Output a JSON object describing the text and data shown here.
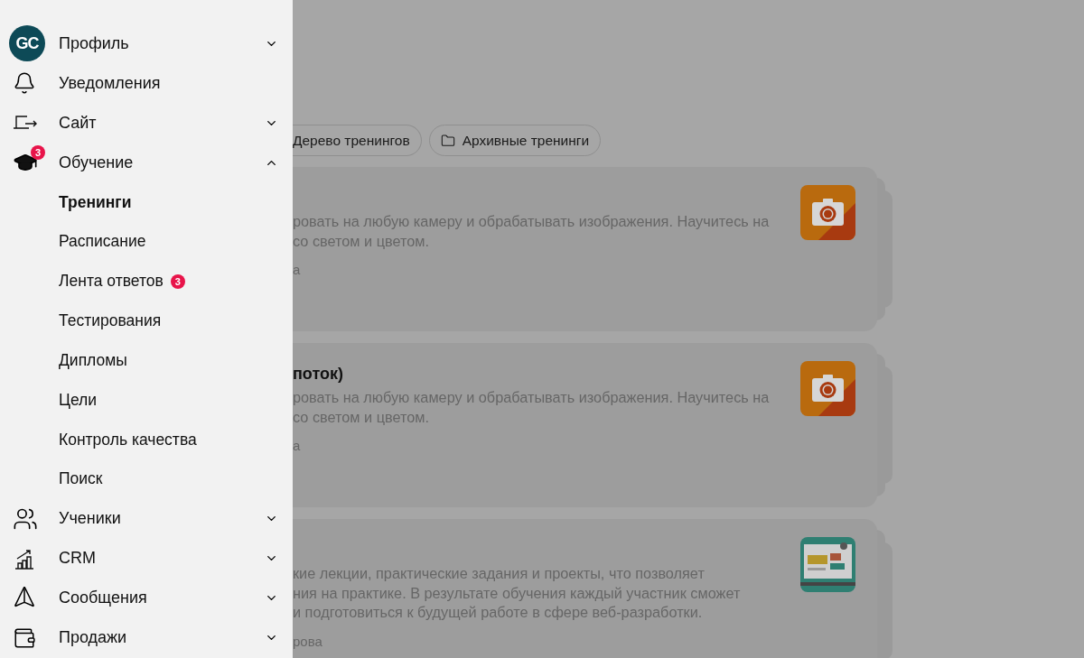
{
  "sidebar": {
    "avatar": "GC",
    "items": [
      {
        "label": "Профиль",
        "kind": "profile",
        "expanded": false
      },
      {
        "label": "Уведомления",
        "kind": "bell"
      },
      {
        "label": "Сайт",
        "kind": "site",
        "expanded": false
      },
      {
        "label": "Обучение",
        "kind": "cap",
        "badge": "3",
        "expanded": true,
        "children": [
          {
            "label": "Тренинги",
            "selected": true
          },
          {
            "label": "Расписание",
            "selected": false
          },
          {
            "label": "Лента ответов",
            "selected": false,
            "badge": "3"
          },
          {
            "label": "Тестирования",
            "selected": false
          },
          {
            "label": "Дипломы",
            "selected": false
          },
          {
            "label": "Цели",
            "selected": false
          },
          {
            "label": "Контроль качества",
            "selected": false
          },
          {
            "label": "Поиск",
            "selected": false
          }
        ]
      },
      {
        "label": "Ученики",
        "kind": "users",
        "expanded": false
      },
      {
        "label": "CRM",
        "kind": "chart",
        "expanded": false
      },
      {
        "label": "Сообщения",
        "kind": "send",
        "expanded": false
      },
      {
        "label": "Продажи",
        "kind": "wallet",
        "expanded": false
      }
    ]
  },
  "tabs": [
    {
      "label": "Дерево тренингов",
      "kind": "tree"
    },
    {
      "label": "Архивные тренинги",
      "kind": "folder"
    }
  ],
  "cards": [
    {
      "lines": [
        "ровать на любую камеру и обрабатывать изображения. Научитесь на",
        "со светом и цветом."
      ],
      "author": "а",
      "kind": "camera"
    },
    {
      "title": "поток)",
      "lines": [
        "ровать на любую камеру и обрабатывать изображения. Научитесь на",
        "со светом и цветом."
      ],
      "author": "а",
      "kind": "camera"
    },
    {
      "lines": [
        "кие лекции, практические задания и проекты, что позволяет",
        "ния на практике. В результате обучения каждый участник сможет",
        "и подготовиться к будущей работе в сфере веб-разработки."
      ],
      "author": "рова",
      "kind": "web"
    }
  ]
}
